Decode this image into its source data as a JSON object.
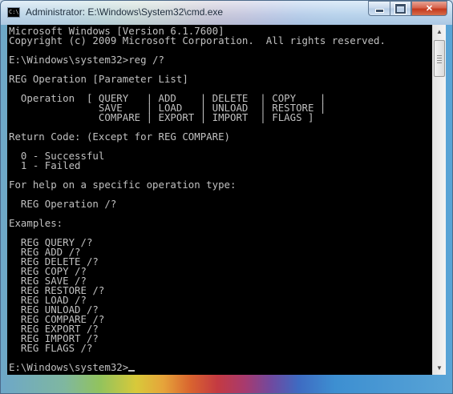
{
  "window": {
    "title": "Administrator: E:\\Windows\\System32\\cmd.exe",
    "icon": "cmd-icon",
    "icon_glyph": "C:\\",
    "buttons": {
      "minimize": "minimize-icon",
      "maximize": "maximize-icon",
      "close_glyph": "✕"
    }
  },
  "console": {
    "lines": [
      "Microsoft Windows [Version 6.1.7600]",
      "Copyright (c) 2009 Microsoft Corporation.  All rights reserved.",
      "",
      "E:\\Windows\\system32>reg /?",
      "",
      "REG Operation [Parameter List]",
      "",
      "  Operation  [ QUERY   | ADD    | DELETE  | COPY    |",
      "               SAVE    | LOAD   | UNLOAD  | RESTORE |",
      "               COMPARE | EXPORT | IMPORT  | FLAGS ]",
      "",
      "Return Code: (Except for REG COMPARE)",
      "",
      "  0 - Successful",
      "  1 - Failed",
      "",
      "For help on a specific operation type:",
      "",
      "  REG Operation /?",
      "",
      "Examples:",
      "",
      "  REG QUERY /?",
      "  REG ADD /?",
      "  REG DELETE /?",
      "  REG COPY /?",
      "  REG SAVE /?",
      "  REG RESTORE /?",
      "  REG LOAD /?",
      "  REG UNLOAD /?",
      "  REG COMPARE /?",
      "  REG EXPORT /?",
      "  REG IMPORT /?",
      "  REG FLAGS /?",
      "",
      "E:\\Windows\\system32>"
    ],
    "text_color": "#c0c0c0",
    "background": "#000000"
  },
  "scrollbar": {
    "up_glyph": "▲",
    "down_glyph": "▼"
  }
}
